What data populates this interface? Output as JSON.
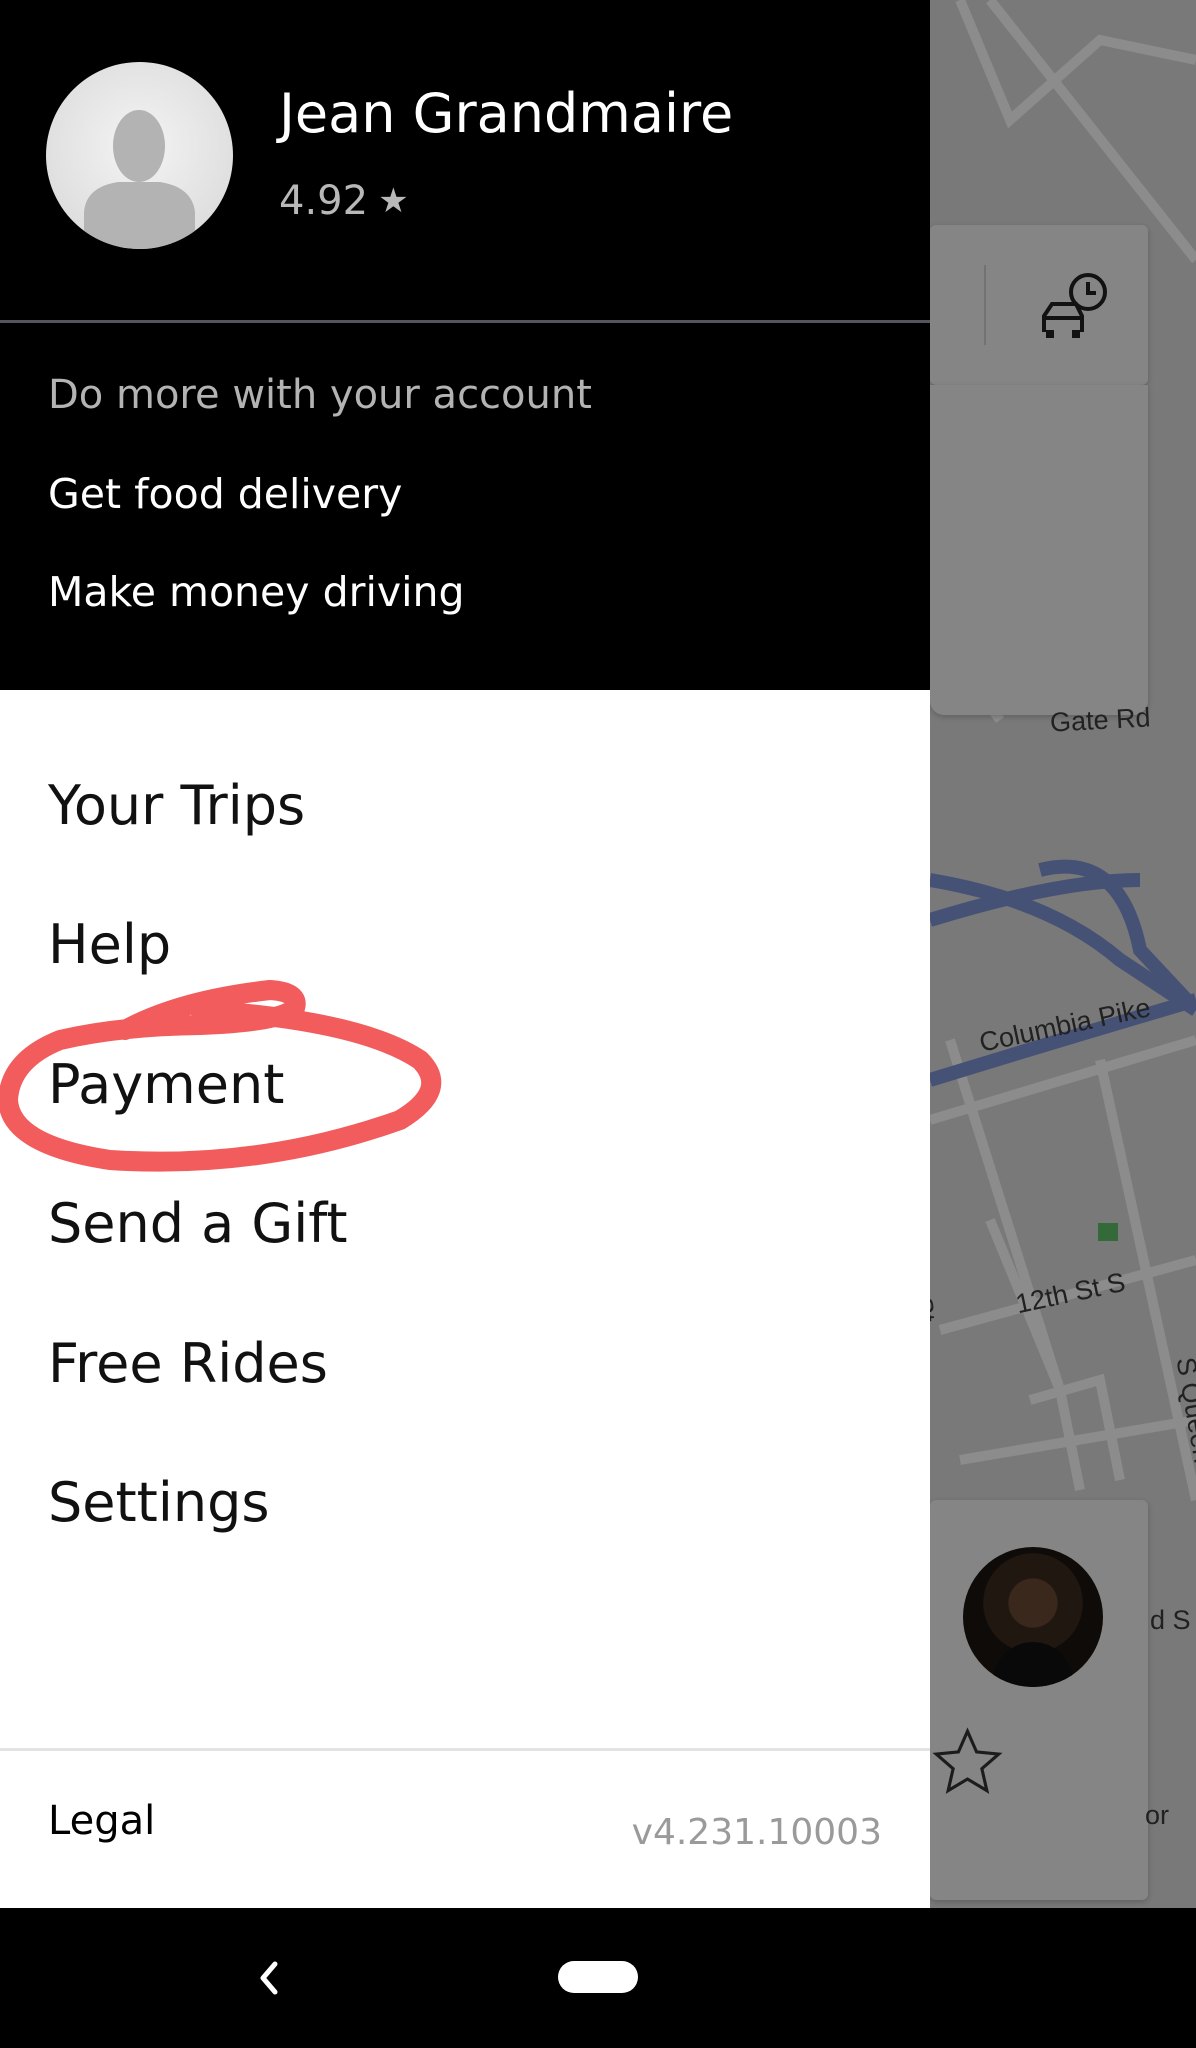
{
  "profile": {
    "name": "Jean Grandmaire",
    "rating": "4.92",
    "rating_icon": "star-icon"
  },
  "promo": {
    "title": "Do more with your account",
    "links": [
      "Get food delivery",
      "Make money driving"
    ]
  },
  "menu": {
    "items": [
      "Your Trips",
      "Help",
      "Payment",
      "Send a Gift",
      "Free Rides",
      "Settings"
    ]
  },
  "footer": {
    "legal": "Legal",
    "version": "v4.231.10003"
  },
  "map": {
    "labels": [
      "Gate Rd",
      "Columbia Pike",
      "S Rolfe St",
      "12th St S",
      "S Queen St",
      "d S",
      "or"
    ]
  },
  "colors": {
    "header_bg": "#000000",
    "annotation": "#f25c5c",
    "map_highway": "#7f96d8"
  }
}
